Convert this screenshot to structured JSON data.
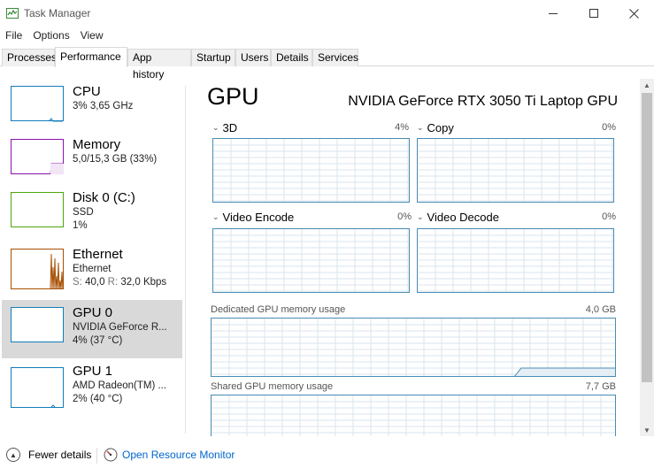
{
  "window": {
    "title": "Task Manager",
    "icons": {
      "app": "task-manager-icon",
      "minimize": "minimize-icon",
      "maximize": "maximize-icon",
      "close": "close-icon"
    }
  },
  "menu": [
    {
      "label": "File"
    },
    {
      "label": "Options"
    },
    {
      "label": "View"
    }
  ],
  "tabs": [
    {
      "label": "Processes",
      "active": false
    },
    {
      "label": "Performance",
      "active": true
    },
    {
      "label": "App history",
      "active": false
    },
    {
      "label": "Startup",
      "active": false
    },
    {
      "label": "Users",
      "active": false
    },
    {
      "label": "Details",
      "active": false
    },
    {
      "label": "Services",
      "active": false
    }
  ],
  "sidebar": [
    {
      "name": "CPU",
      "line1": "3% 3,65 GHz",
      "line2": "",
      "color": "#117dbb"
    },
    {
      "name": "Memory",
      "line1": "5,0/15,3 GB (33%)",
      "line2": "",
      "color": "#8b12ae"
    },
    {
      "name": "Disk 0 (C:)",
      "line1": "SSD",
      "line2": "1%",
      "color": "#4da60c"
    },
    {
      "name": "Ethernet",
      "line1": "Ethernet",
      "line2_s_label": "S:",
      "line2_s": "40,0",
      "line2_r_label": "R:",
      "line2_r": "32,0 Kbps",
      "color": "#a74f01"
    },
    {
      "name": "GPU 0",
      "line1": "NVIDIA GeForce R...",
      "line2": "4% (37 °C)",
      "color": "#117dbb",
      "selected": true
    },
    {
      "name": "GPU 1",
      "line1": "AMD Radeon(TM) ...",
      "line2": "2% (40 °C)",
      "color": "#117dbb"
    }
  ],
  "main": {
    "title": "GPU",
    "model": "NVIDIA GeForce RTX 3050 Ti Laptop GPU",
    "engines": [
      {
        "label": "3D",
        "pct": "4%"
      },
      {
        "label": "Copy",
        "pct": "0%"
      },
      {
        "label": "Video Encode",
        "pct": "0%"
      },
      {
        "label": "Video Decode",
        "pct": "0%"
      }
    ],
    "dedicated": {
      "label": "Dedicated GPU memory usage",
      "value": "4,0 GB"
    },
    "shared": {
      "label": "Shared GPU memory usage",
      "value": "7,7 GB"
    },
    "graph_color": "#4a8cb5"
  },
  "footer": {
    "fewer": "Fewer details",
    "resource_monitor": "Open Resource Monitor",
    "icons": {
      "fewer": "chevron-up-icon",
      "resmon": "resource-monitor-icon"
    }
  }
}
